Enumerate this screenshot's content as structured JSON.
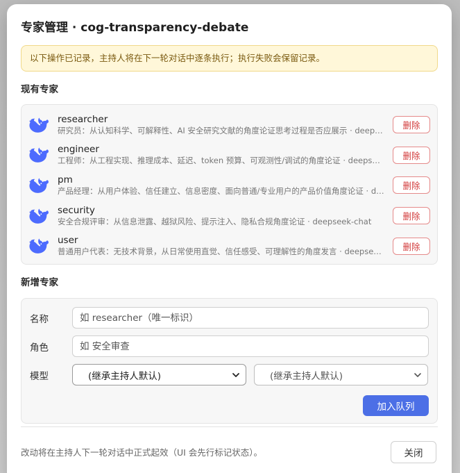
{
  "dialog": {
    "title": "专家管理 · cog-transparency-debate",
    "notice": "以下操作已记录，主持人将在下一轮对话中逐条执行；执行失败会保留记录。"
  },
  "existing": {
    "section_label": "现有专家",
    "delete_label": "删除",
    "icon": "whale-icon",
    "icon_color": "#4d6bfe",
    "experts": [
      {
        "name": "researcher",
        "desc": "研究员：从认知科学、可解释性、AI 安全研究文献的角度论证思考过程是否应展示 · deepseek-chat"
      },
      {
        "name": "engineer",
        "desc": "工程师：从工程实现、推理成本、延迟、token 预算、可观测性/调试的角度论证 · deepseek-chat"
      },
      {
        "name": "pm",
        "desc": "产品经理：从用户体验、信任建立、信息密度、面向普通/专业用户的产品价值角度论证 · deepseek-chat"
      },
      {
        "name": "security",
        "desc": "安全合规评审：从信息泄露、越狱风险、提示注入、隐私合规角度论证 · deepseek-chat"
      },
      {
        "name": "user",
        "desc": "普通用户代表：无技术背景，从日常使用直觉、信任感受、可理解性的角度发言 · deepseek-chat"
      }
    ]
  },
  "add_form": {
    "section_label": "新增专家",
    "name_label": "名称",
    "name_placeholder": "如 researcher（唯一标识）",
    "role_label": "角色",
    "role_placeholder": "如 安全审查",
    "model_label": "模型",
    "model_value": "(继承主持人默认)",
    "model_secondary_value": "(继承主持人默认)",
    "submit_label": "加入队列",
    "accent": "#4c6fe6"
  },
  "footer": {
    "note": "改动将在主持人下一轮对话中正式起效（UI 会先行标记状态）。",
    "close_label": "关闭"
  }
}
